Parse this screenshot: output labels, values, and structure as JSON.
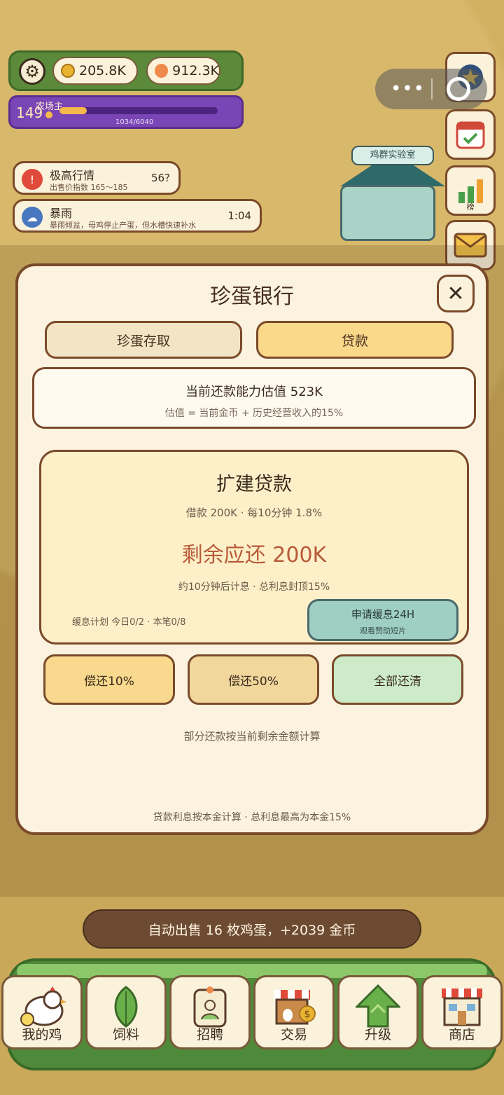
{
  "hud": {
    "gold": "205.8K",
    "gems": "912.3K",
    "level": "149",
    "title": "农场主",
    "progress_text": "1034/6040",
    "progress_fraction": 0.171
  },
  "notices": [
    {
      "title": "极高行情",
      "sub": "出售价指数 165～185",
      "right": "56?",
      "icon": "alert-icon",
      "color": "#e04a3a"
    },
    {
      "title": "暴雨",
      "sub": "暴雨倾盆，母鸡停止产蛋，但水槽快速补水",
      "right": "1:04",
      "icon": "rain-cloud-icon",
      "color": "#4a78c0"
    }
  ],
  "side": {
    "rank_label": "榜"
  },
  "lab_sign": "鸡群实验室",
  "modal": {
    "title": "珍蛋银行",
    "tabs": [
      "珍蛋存取",
      "贷款"
    ],
    "estimate_line": "当前还款能力估值 523K",
    "estimate_formula": "估值 = 当前金币 + 历史经营收入的15%",
    "loan": {
      "title": "扩建贷款",
      "terms": "借款 200K · 每10分钟 1.8%",
      "remaining": "剩余应还 200K",
      "note": "约10分钟后计息 · 总利息封顶15%",
      "plan": "缓息计划 今日0/2 · 本笔0/8",
      "grace_title": "申请缓息24H",
      "grace_sub": "观看赞助短片"
    },
    "pay_buttons": [
      "偿还10%",
      "偿还50%",
      "全部还清"
    ],
    "hint": "部分还款按当前剩余金额计算",
    "footer": "贷款利息按本金计算 · 总利息最高为本金15%"
  },
  "toast": "自动出售 16 枚鸡蛋，+2039 金币",
  "nav": [
    "我的鸡",
    "饲料",
    "招聘",
    "交易",
    "升级",
    "商店"
  ],
  "colors": {
    "accent_green": "#4f8a3a",
    "panel": "#fbf3e0",
    "border": "#7a4a2a",
    "loan_red": "#b85a3a"
  }
}
